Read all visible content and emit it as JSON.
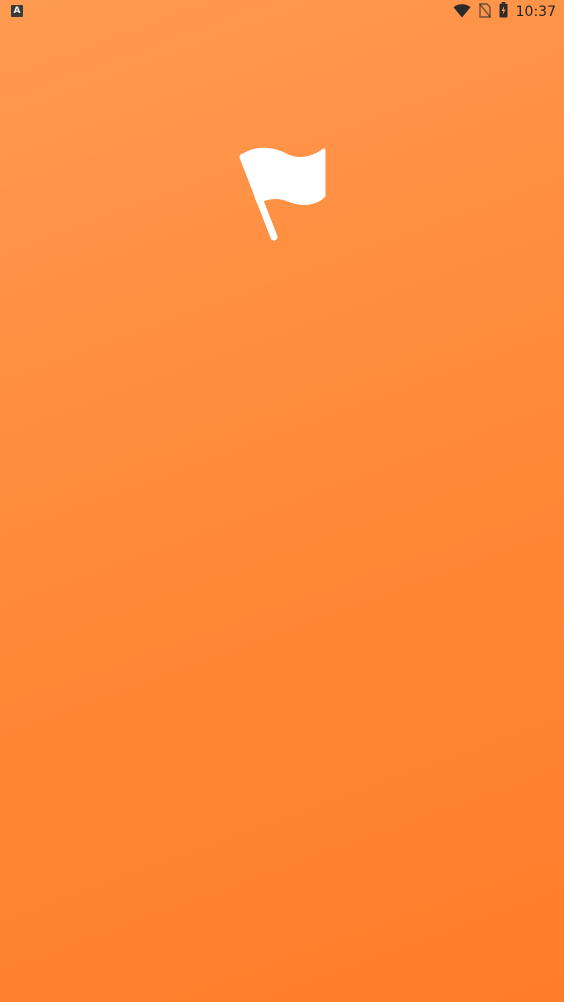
{
  "status_bar": {
    "notification_letter": "A",
    "time": "10:37",
    "icons": [
      "wifi-icon",
      "no-sim-icon",
      "battery-charging-icon"
    ]
  },
  "splash": {
    "logo_icon": "flag-icon",
    "background_colors": [
      "#FF9A52",
      "#FF7C2A"
    ]
  }
}
